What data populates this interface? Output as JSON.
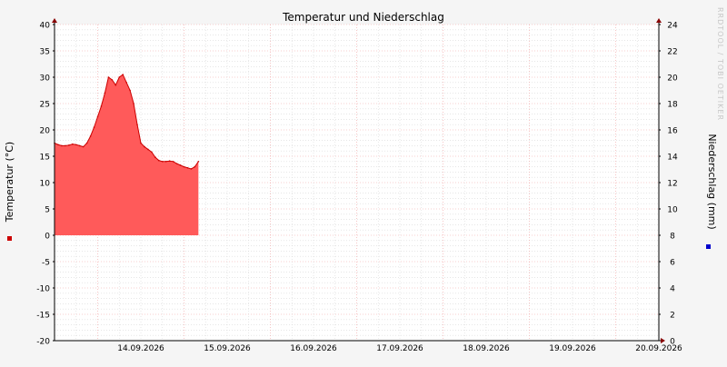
{
  "chart_data": {
    "type": "area",
    "title": "Temperatur und Niederschlag",
    "watermark": "RRDTOOL / TOBI OETIKER",
    "ylabel_left": "Temperatur (°C)",
    "ylabel_right": "Niederschlag (mm)",
    "ylim_left": [
      -20,
      40
    ],
    "ylim_right": [
      0,
      24
    ],
    "y_ticks_left": [
      "40",
      "35",
      "30",
      "25",
      "20",
      "15",
      "10",
      "5",
      "0",
      "-5",
      "-10",
      "-15",
      "-20"
    ],
    "y_ticks_right": [
      "24",
      "22",
      "20",
      "18",
      "16",
      "14",
      "12",
      "10",
      "8",
      "6",
      "4",
      "2",
      "0"
    ],
    "x_start": "13.09.2026 12:00",
    "x_end": "20.09.2026 12:00",
    "x_tick_labels": [
      "14.09.2026",
      "15.09.2026",
      "16.09.2026",
      "17.09.2026",
      "18.09.2026",
      "19.09.2026",
      "20.09.2026"
    ],
    "grid": true,
    "colors": {
      "area_fill": "#ff5a5a",
      "area_line": "#cc0000",
      "grid_major": "#f0a0a0",
      "grid_minor": "#d8d8d8",
      "legend_temp": "#cc0000",
      "legend_precip": "#0000cc",
      "background": "#f5f5f5",
      "plot_background": "#ffffff"
    },
    "series": [
      {
        "name": "Temperatur",
        "axis": "left",
        "x": [
          "13.09.2026 12:00",
          "13.09.2026 13:00",
          "13.09.2026 14:00",
          "13.09.2026 15:00",
          "13.09.2026 16:00",
          "13.09.2026 17:00",
          "13.09.2026 18:00",
          "13.09.2026 19:00",
          "13.09.2026 20:00",
          "13.09.2026 21:00",
          "13.09.2026 22:00",
          "13.09.2026 23:00",
          "14.09.2026 00:00",
          "14.09.2026 01:00",
          "14.09.2026 02:00",
          "14.09.2026 03:00",
          "14.09.2026 04:00",
          "14.09.2026 05:00",
          "14.09.2026 06:00",
          "14.09.2026 07:00",
          "14.09.2026 08:00",
          "14.09.2026 09:00",
          "14.09.2026 10:00",
          "14.09.2026 11:00",
          "14.09.2026 12:00",
          "14.09.2026 13:00",
          "14.09.2026 14:00",
          "14.09.2026 15:00",
          "14.09.2026 16:00",
          "14.09.2026 17:00",
          "14.09.2026 18:00",
          "14.09.2026 19:00",
          "14.09.2026 20:00",
          "14.09.2026 21:00",
          "14.09.2026 22:00",
          "14.09.2026 23:00",
          "15.09.2026 00:00",
          "15.09.2026 01:00",
          "15.09.2026 02:00",
          "15.09.2026 03:00",
          "15.09.2026 04:00"
        ],
        "values": [
          17.5,
          17.2,
          17.0,
          17.0,
          17.1,
          17.3,
          17.2,
          17.0,
          16.8,
          17.5,
          18.8,
          20.5,
          22.5,
          24.5,
          27.0,
          30.0,
          29.5,
          28.5,
          30.0,
          30.5,
          29.0,
          27.5,
          25.0,
          21.0,
          17.5,
          16.8,
          16.3,
          15.8,
          14.8,
          14.2,
          14.0,
          14.0,
          14.1,
          14.0,
          13.6,
          13.3,
          13.0,
          12.8,
          12.6,
          13.0,
          14.0
        ]
      },
      {
        "name": "Niederschlag",
        "axis": "right",
        "x": [],
        "values": []
      }
    ]
  }
}
